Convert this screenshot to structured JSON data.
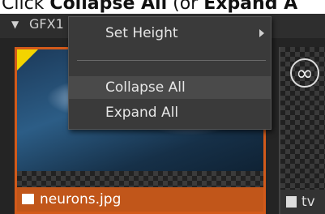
{
  "caption": {
    "lead": "Click ",
    "bold1": "Collapse All",
    "mid": " (or ",
    "bold2": "Expand A"
  },
  "panel": {
    "title": "GFX1"
  },
  "clips": [
    {
      "name": "neurons.jpg",
      "icon": "image-icon",
      "selected": true
    },
    {
      "name": "tv",
      "icon": "film-icon",
      "selected": false
    }
  ],
  "context_menu": {
    "items": [
      {
        "label": "Set Height",
        "submenu": true
      },
      {
        "label": "Collapse All",
        "submenu": false
      },
      {
        "label": "Expand All",
        "submenu": false
      }
    ]
  },
  "colors": {
    "selection": "#c1561a",
    "marker": "#f3d400",
    "menu_bg": "#3a3a3a"
  }
}
